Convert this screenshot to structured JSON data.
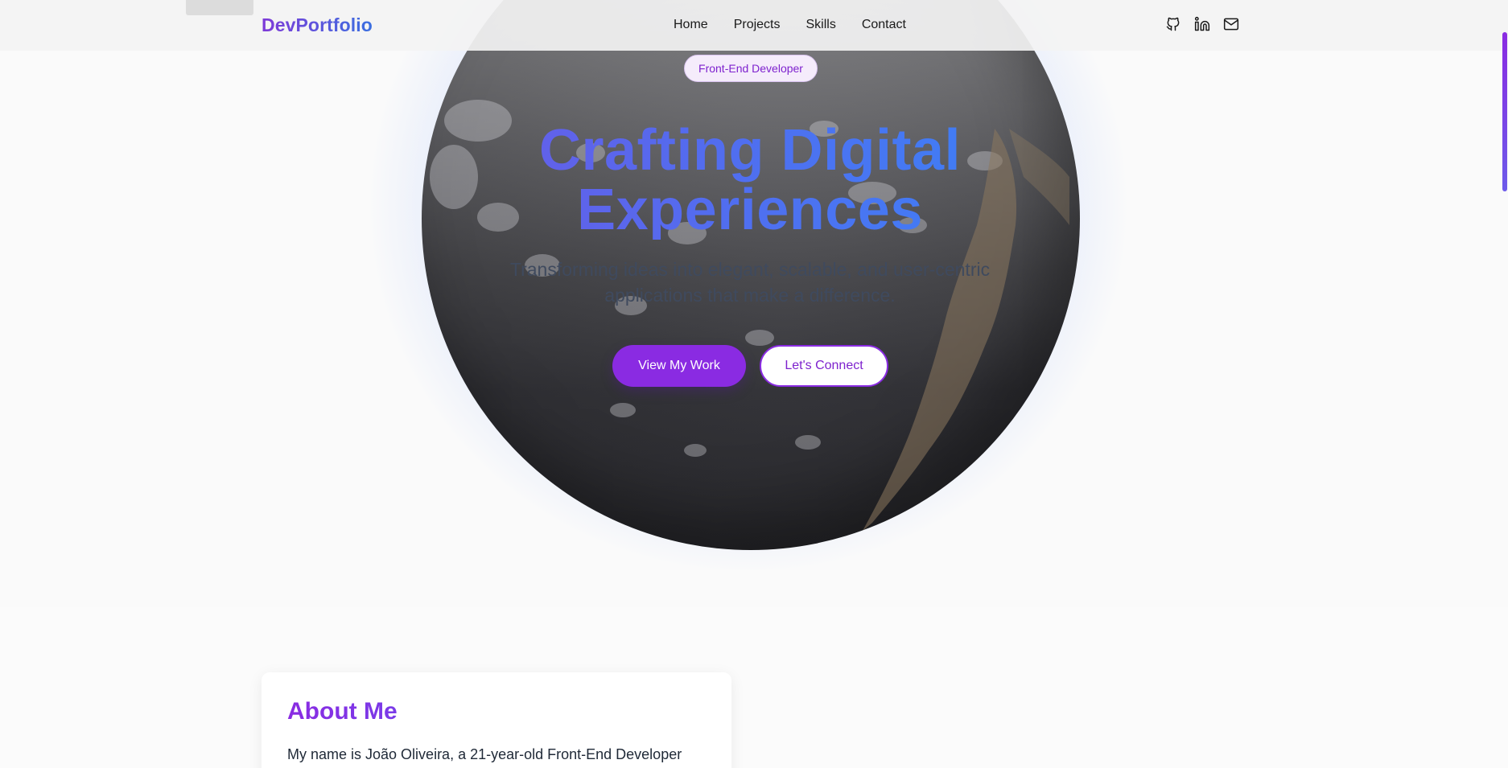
{
  "brand": "DevPortfolio",
  "nav": {
    "links": [
      "Home",
      "Projects",
      "Skills",
      "Contact"
    ],
    "icons": [
      "github-icon",
      "linkedin-icon",
      "mail-icon"
    ]
  },
  "hero": {
    "badge": "Front-End Developer",
    "title_line1": "Crafting Digital",
    "title_line2": "Experiences",
    "subtitle_line1": "Transforming ideas into elegant, scalable, and user-centric",
    "subtitle_line2": "applications that make a difference.",
    "primary_button": "View My Work",
    "secondary_button": "Let's Connect"
  },
  "about": {
    "title": "About Me",
    "text": "My name is João Oliveira, a 21-year-old Front-End Developer"
  },
  "colors": {
    "accent": "#8a2be2",
    "brand_gradient_start": "#7e3ad8",
    "brand_gradient_end": "#3b6fe0",
    "globe_glow": "#6096ff"
  }
}
